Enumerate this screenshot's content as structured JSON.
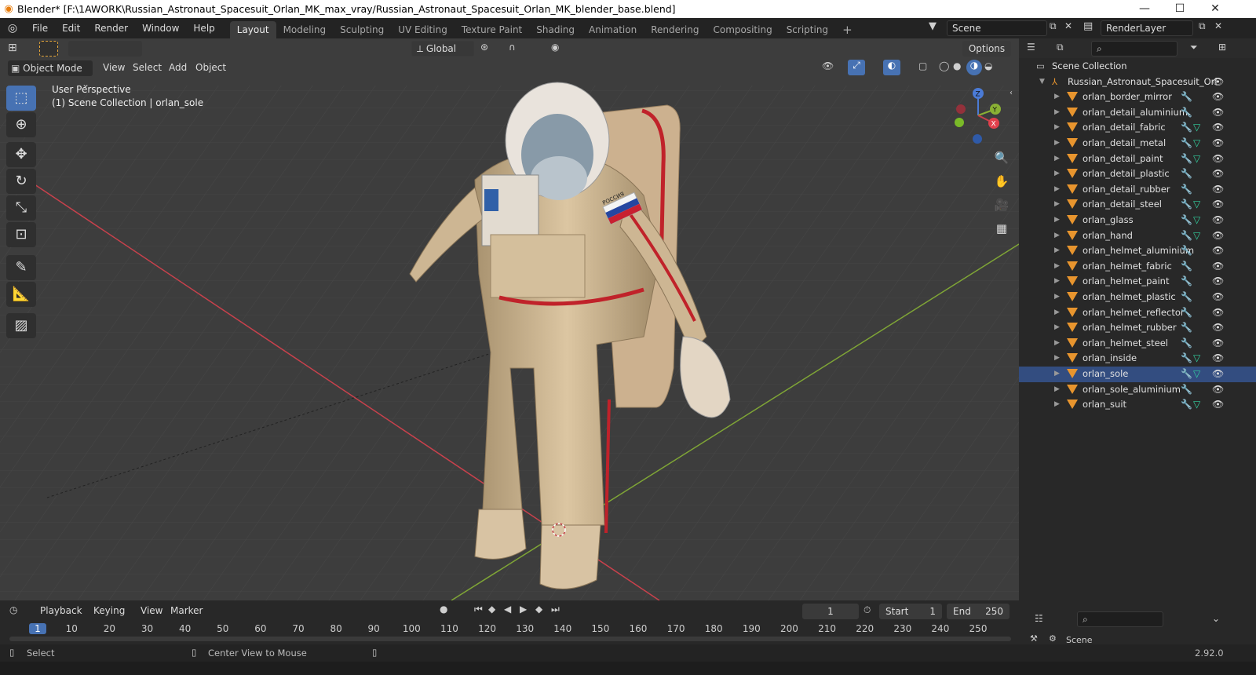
{
  "window": {
    "title": "Blender* [F:\\1AWORK\\Russian_Astronaut_Spacesuit_Orlan_MK_max_vray/Russian_Astronaut_Spacesuit_Orlan_MK_blender_base.blend]",
    "minimize": "—",
    "maximize": "☐",
    "close": "✕"
  },
  "menu": {
    "file": "File",
    "edit": "Edit",
    "render": "Render",
    "window": "Window",
    "help": "Help"
  },
  "workspaces": [
    "Layout",
    "Modeling",
    "Sculpting",
    "UV Editing",
    "Texture Paint",
    "Shading",
    "Animation",
    "Rendering",
    "Compositing",
    "Scripting"
  ],
  "add_workspace": "+",
  "scene": {
    "name": "Scene",
    "render_layer": "RenderLayer"
  },
  "viewport": {
    "transform_orientation": "Global",
    "options": "Options",
    "mode": "Object Mode",
    "menus": {
      "view": "View",
      "select": "Select",
      "add": "Add",
      "object": "Object"
    },
    "info_line1": "User Perspective",
    "info_line2": "(1) Scene Collection | orlan_sole",
    "gizmo": {
      "x": "X",
      "y": "Y",
      "z": "Z"
    },
    "patch_text": "РОССИЯ"
  },
  "outliner": {
    "root": "Scene Collection",
    "parent": "Russian_Astronaut_Spacesuit_Orl",
    "items": [
      {
        "name": "orlan_border_mirror",
        "mesh": false
      },
      {
        "name": "orlan_detail_aluminium",
        "mesh": false
      },
      {
        "name": "orlan_detail_fabric",
        "mesh": true
      },
      {
        "name": "orlan_detail_metal",
        "mesh": true
      },
      {
        "name": "orlan_detail_paint",
        "mesh": true
      },
      {
        "name": "orlan_detail_plastic",
        "mesh": false
      },
      {
        "name": "orlan_detail_rubber",
        "mesh": false
      },
      {
        "name": "orlan_detail_steel",
        "mesh": true
      },
      {
        "name": "orlan_glass",
        "mesh": true
      },
      {
        "name": "orlan_hand",
        "mesh": true
      },
      {
        "name": "orlan_helmet_aluminium",
        "mesh": false
      },
      {
        "name": "orlan_helmet_fabric",
        "mesh": false
      },
      {
        "name": "orlan_helmet_paint",
        "mesh": false
      },
      {
        "name": "orlan_helmet_plastic",
        "mesh": false
      },
      {
        "name": "orlan_helmet_reflector",
        "mesh": false
      },
      {
        "name": "orlan_helmet_rubber",
        "mesh": false
      },
      {
        "name": "orlan_helmet_steel",
        "mesh": false
      },
      {
        "name": "orlan_inside",
        "mesh": true
      },
      {
        "name": "orlan_sole",
        "mesh": true
      },
      {
        "name": "orlan_sole_aluminium",
        "mesh": false
      },
      {
        "name": "orlan_suit",
        "mesh": true
      }
    ]
  },
  "timeline": {
    "menus": {
      "playback": "Playback",
      "keying": "Keying",
      "view": "View",
      "marker": "Marker"
    },
    "current_frame": "1",
    "start_label": "Start",
    "start": "1",
    "end_label": "End",
    "end": "250",
    "ruler": [
      "1",
      "10",
      "20",
      "30",
      "40",
      "50",
      "60",
      "70",
      "80",
      "90",
      "100",
      "110",
      "120",
      "130",
      "140",
      "150",
      "160",
      "170",
      "180",
      "190",
      "200",
      "210",
      "220",
      "230",
      "240",
      "250"
    ]
  },
  "properties": {
    "scene_label": "Scene"
  },
  "status": {
    "select": "Select",
    "center_view": "Center View to Mouse",
    "version": "2.92.0"
  },
  "colors": {
    "accent": "#4772b3",
    "object_orange": "#e8952e",
    "mesh_green": "#32d2a0",
    "modifier_blue": "#6fa0ff",
    "x_axis": "#c8414c",
    "y_axis": "#8ab034"
  }
}
